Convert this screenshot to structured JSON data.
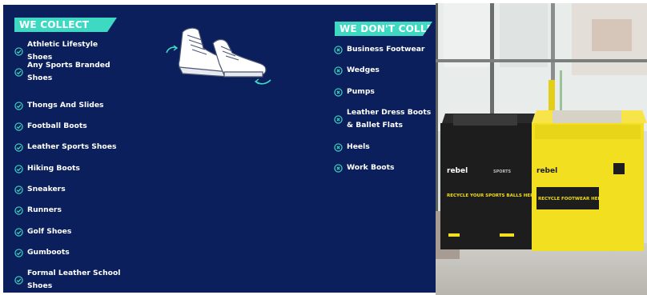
{
  "collect": {
    "heading": "WE COLLECT",
    "items": [
      "Athletic Lifestyle Shoes",
      "Any Sports Branded Shoes",
      "Thongs And Slides",
      "Football Boots",
      "Leather Sports Shoes",
      "Hiking Boots",
      "Sneakers",
      "Runners",
      "Golf Shoes",
      "Gumboots",
      "Formal Leather School Shoes"
    ]
  },
  "dont_collect": {
    "heading": "WE DON'T COLLECT",
    "items": [
      "Business Footwear",
      "Wedges",
      "Pumps",
      "Leather Dress Boots & Ballet Flats",
      "Heels",
      "Work Boots"
    ]
  },
  "bins": {
    "left": {
      "brand": "rebel",
      "sub": "SPORTS",
      "text": "RECYCLE YOUR SPORTS BALLS HERE"
    },
    "right": {
      "brand": "rebel",
      "text": "RECYCLE FOOTWEAR HERE"
    }
  },
  "icons": {
    "accepted": "check-circle-icon",
    "rejected": "x-circle-icon",
    "illustration": "shoes-illustration"
  },
  "colors": {
    "panel_bg": "#0b1f5c",
    "accent": "#3ed9c3",
    "text": "#ffffff",
    "bin_black": "#1d1d1d",
    "bin_yellow": "#f2df1f"
  }
}
